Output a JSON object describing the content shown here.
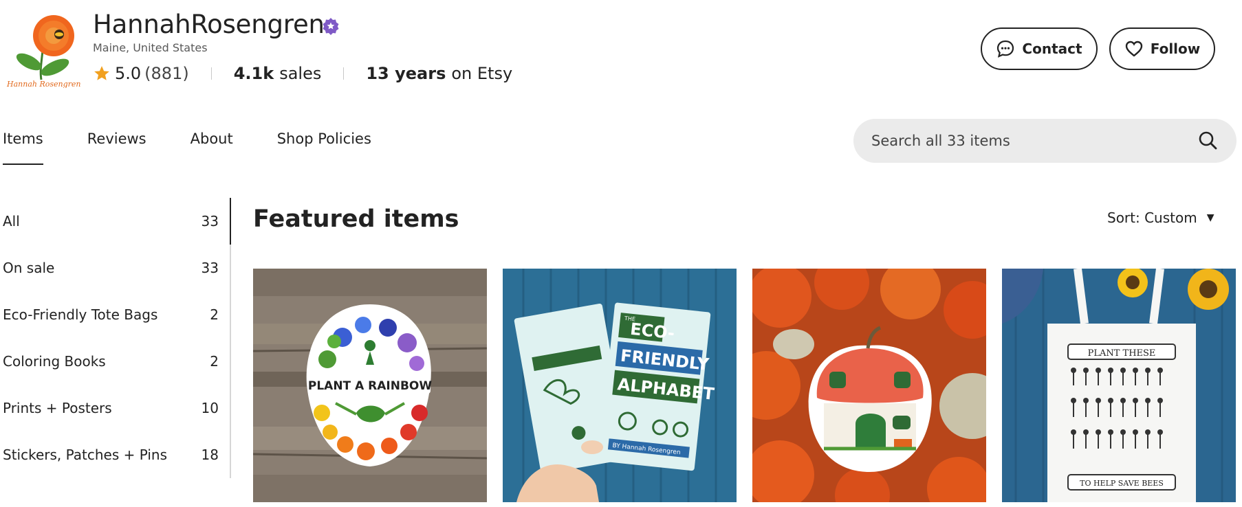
{
  "shop": {
    "logo_text": "Hannah Rosengren",
    "name": "HannahRosengren",
    "location": "Maine, United States",
    "rating": "5.0",
    "rating_count": "(881)",
    "sales_value": "4.1k",
    "sales_label": "sales",
    "years_value": "13 years",
    "years_label": "on Etsy"
  },
  "actions": {
    "contact_label": "Contact",
    "follow_label": "Follow"
  },
  "tabs": [
    {
      "label": "Items",
      "active": true
    },
    {
      "label": "Reviews"
    },
    {
      "label": "About"
    },
    {
      "label": "Shop Policies"
    }
  ],
  "search": {
    "placeholder": "Search all 33 items"
  },
  "sidebar": {
    "categories": [
      {
        "label": "All",
        "count": "33",
        "active": true
      },
      {
        "label": "On sale",
        "count": "33"
      },
      {
        "label": "Eco-Friendly Tote Bags",
        "count": "2"
      },
      {
        "label": "Coloring Books",
        "count": "2"
      },
      {
        "label": "Prints + Posters",
        "count": "10"
      },
      {
        "label": "Stickers, Patches + Pins",
        "count": "18"
      }
    ]
  },
  "featured": {
    "title": "Featured items",
    "sort_label": "Sort: Custom",
    "items": [
      {
        "image_text": "PLANT A RAINBOW"
      },
      {
        "image_text_1": "THE",
        "image_text_2": "ECO-",
        "image_text_3": "FRIENDLY",
        "image_text_4": "ALPHABET",
        "image_text_5": "BY Hannah Rosengren"
      },
      {
        "image_text": ""
      },
      {
        "image_text_1": "PLANT THESE",
        "image_text_2": "TO HELP SAVE BEES"
      }
    ]
  },
  "colors": {
    "accent_purple": "#7f5ac6",
    "star": "#f1a01f",
    "text": "#222222",
    "search_bg": "#ebebeb"
  },
  "icons": [
    "zinnia-logo",
    "star-seller-badge-icon",
    "star-icon",
    "chat-bubble-icon",
    "heart-icon",
    "search-icon",
    "caret-down-icon"
  ]
}
